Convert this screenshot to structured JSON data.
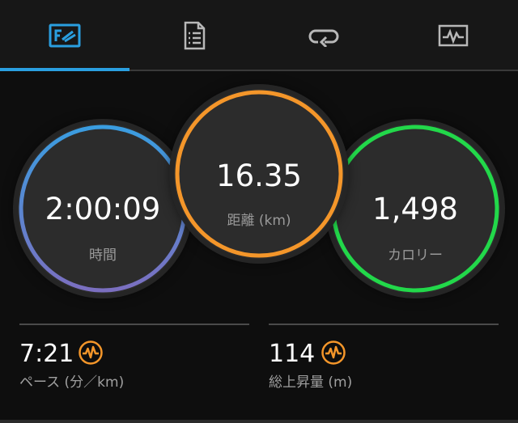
{
  "tabs": [
    {
      "name": "overview",
      "icon": "dashboard-icon",
      "active": true
    },
    {
      "name": "details",
      "icon": "document-icon",
      "active": false
    },
    {
      "name": "laps",
      "icon": "loop-icon",
      "active": false
    },
    {
      "name": "graphs",
      "icon": "chart-icon",
      "active": false
    }
  ],
  "colors": {
    "accent": "#2a9fe0",
    "time_ring": [
      "#3a9de0",
      "#7b6fc0"
    ],
    "distance_ring": "#f4962a",
    "calories_ring": "#22d84a",
    "hr_icon": "#f4962a"
  },
  "summary": {
    "time": {
      "value": "2:00:09",
      "label": "時間"
    },
    "distance": {
      "value": "16.35",
      "label": "距離 (km)"
    },
    "calories": {
      "value": "1,498",
      "label": "カロリー"
    }
  },
  "stats": {
    "pace": {
      "value": "7:21",
      "label": "ペース (分／km)",
      "icon": "heart-rate-icon"
    },
    "elevation": {
      "value": "114",
      "label": "総上昇量 (m)",
      "icon": "heart-rate-icon"
    }
  }
}
